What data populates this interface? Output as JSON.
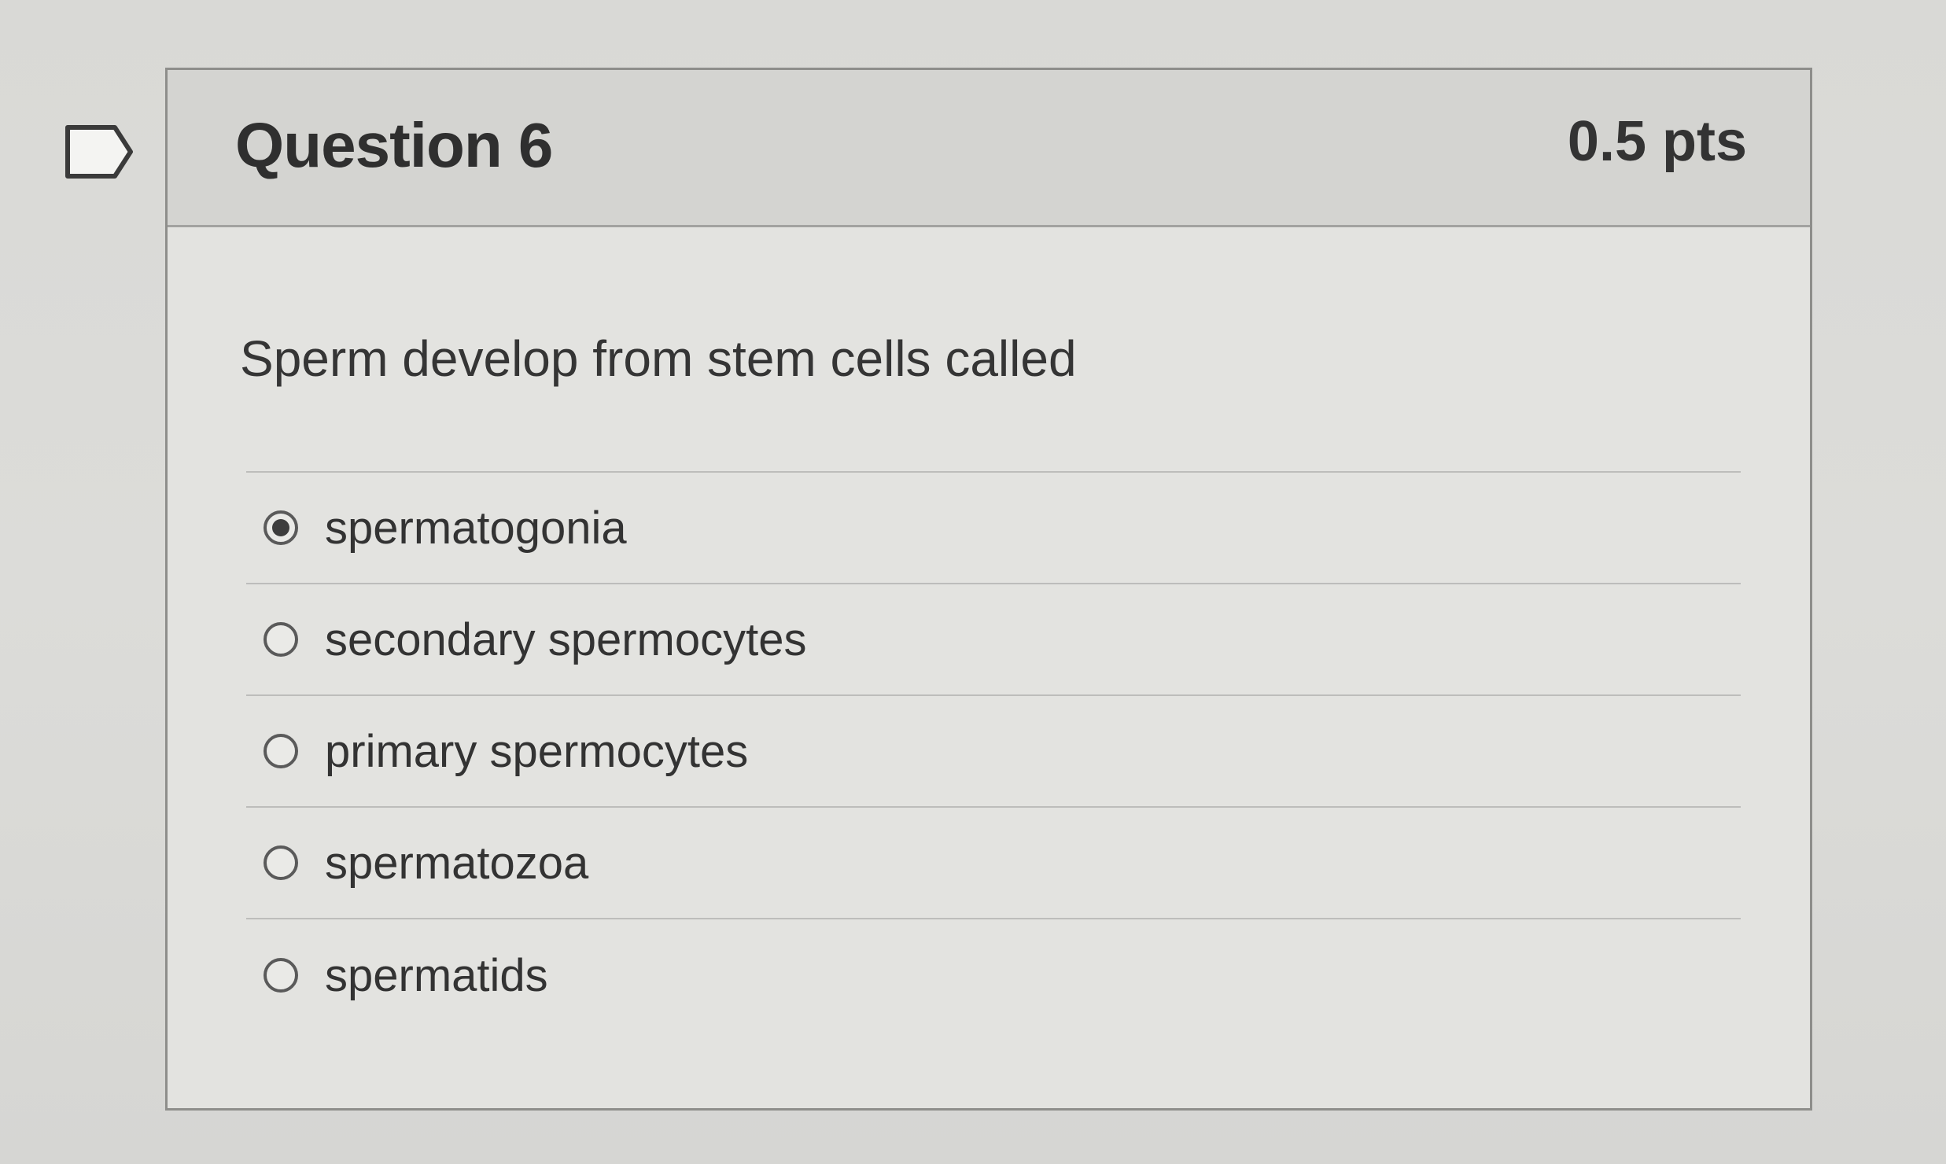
{
  "question": {
    "title": "Question 6",
    "points": "0.5 pts",
    "text": "Sperm develop from stem cells called",
    "flag_icon": "bookmark-flag-icon"
  },
  "answers": [
    {
      "label": "spermatogonia",
      "selected": true
    },
    {
      "label": "secondary spermocytes",
      "selected": false
    },
    {
      "label": "primary spermocytes",
      "selected": false
    },
    {
      "label": "spermatozoa",
      "selected": false
    },
    {
      "label": "spermatids",
      "selected": false
    }
  ],
  "colors": {
    "card_border": "#8e8e8b",
    "header_bg": "#d4d4d1",
    "radio_fill": "#3d3d3d"
  }
}
